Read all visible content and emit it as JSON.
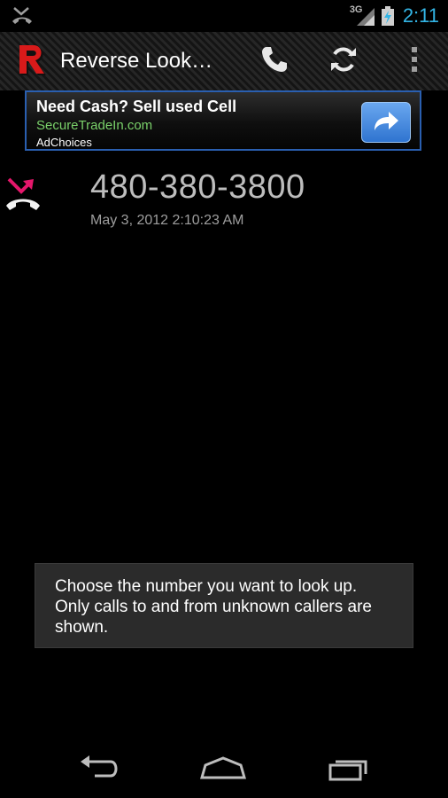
{
  "status_bar": {
    "notification_icon": "missed-call-icon",
    "network": "3G",
    "time": "2:11"
  },
  "action_bar": {
    "title": "Reverse Look…",
    "logo_icon": "app-logo-r-icon",
    "actions": [
      "phone-icon",
      "refresh-icon",
      "overflow-menu-icon"
    ]
  },
  "ad": {
    "headline": "Need Cash? Sell used Cell",
    "url": "SecureTradeIn.com",
    "choices": "AdChoices",
    "button_icon": "share-arrow-icon"
  },
  "call": {
    "type_icon": "missed-call-icon",
    "number": "480-380-3800",
    "timestamp": "May 3, 2012 2:10:23 AM"
  },
  "toast": {
    "message": "Choose the number you want to look up. Only calls to and from unknown callers are shown."
  },
  "nav": {
    "buttons": [
      "back-icon",
      "home-icon",
      "recent-apps-icon"
    ]
  },
  "colors": {
    "clock": "#33b5e5",
    "ad_border": "#2a5fb0",
    "ad_url": "#7ad16a",
    "missed_call": "#e5176b"
  }
}
